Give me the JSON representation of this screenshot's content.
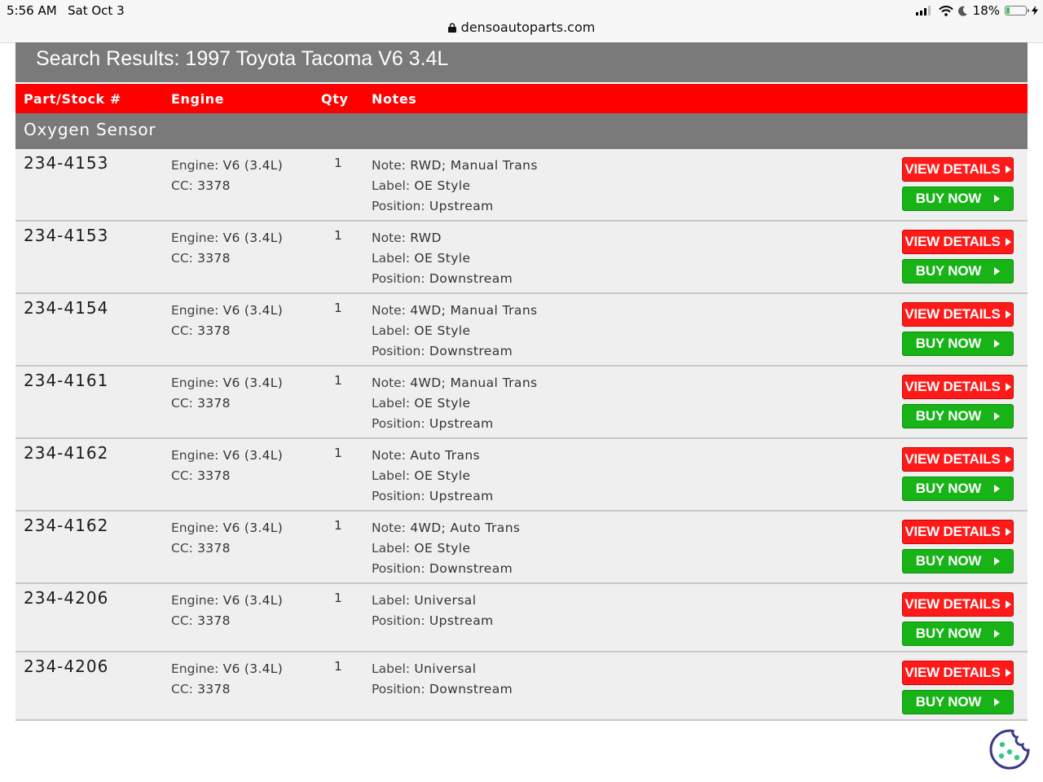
{
  "status_bar": {
    "time": "5:56 AM",
    "date": "Sat Oct 3",
    "url": "densoautoparts.com",
    "battery": "18%",
    "battery_level": 0.18
  },
  "results": {
    "title": "Search Results:  1997 Toyota Tacoma V6 3.4L",
    "columns": [
      "Part/Stock #",
      "Engine",
      "Qty",
      "Notes"
    ],
    "category": "Oxygen Sensor",
    "engine_label": "Engine:",
    "cc_label": "CC:",
    "note_label": "Note:",
    "label_label": "Label:",
    "position_label": "Position:",
    "view_details_label": "VIEW DETAILS",
    "buy_now_label": "BUY NOW",
    "rows": [
      {
        "part": "234-4153",
        "engine": "V6 (3.4L)",
        "cc": "3378",
        "qty": "1",
        "note": "RWD; Manual Trans",
        "label": "OE Style",
        "position": "Upstream"
      },
      {
        "part": "234-4153",
        "engine": "V6 (3.4L)",
        "cc": "3378",
        "qty": "1",
        "note": "RWD",
        "label": "OE Style",
        "position": "Downstream"
      },
      {
        "part": "234-4154",
        "engine": "V6 (3.4L)",
        "cc": "3378",
        "qty": "1",
        "note": "4WD; Manual Trans",
        "label": "OE Style",
        "position": "Downstream"
      },
      {
        "part": "234-4161",
        "engine": "V6 (3.4L)",
        "cc": "3378",
        "qty": "1",
        "note": "4WD; Manual Trans",
        "label": "OE Style",
        "position": "Upstream"
      },
      {
        "part": "234-4162",
        "engine": "V6 (3.4L)",
        "cc": "3378",
        "qty": "1",
        "note": "Auto Trans",
        "label": "OE Style",
        "position": "Upstream"
      },
      {
        "part": "234-4162",
        "engine": "V6 (3.4L)",
        "cc": "3378",
        "qty": "1",
        "note": "4WD; Auto Trans",
        "label": "OE Style",
        "position": "Downstream"
      },
      {
        "part": "234-4206",
        "engine": "V6 (3.4L)",
        "cc": "3378",
        "qty": "1",
        "note": "",
        "label": "Universal",
        "position": "Upstream"
      },
      {
        "part": "234-4206",
        "engine": "V6 (3.4L)",
        "cc": "3378",
        "qty": "1",
        "note": "",
        "label": "Universal",
        "position": "Downstream"
      }
    ]
  },
  "colors": {
    "header_red": "#ff0000",
    "title_gray": "#7a7a7a",
    "view_button": "#ff1a1a",
    "buy_button": "#17b317",
    "cookie_accent": "#3a3a8c"
  },
  "icons": {
    "lock": "lock-icon",
    "battery": "battery-icon",
    "arrow": "arrow-right-icon",
    "cookie": "cookie-icon"
  }
}
